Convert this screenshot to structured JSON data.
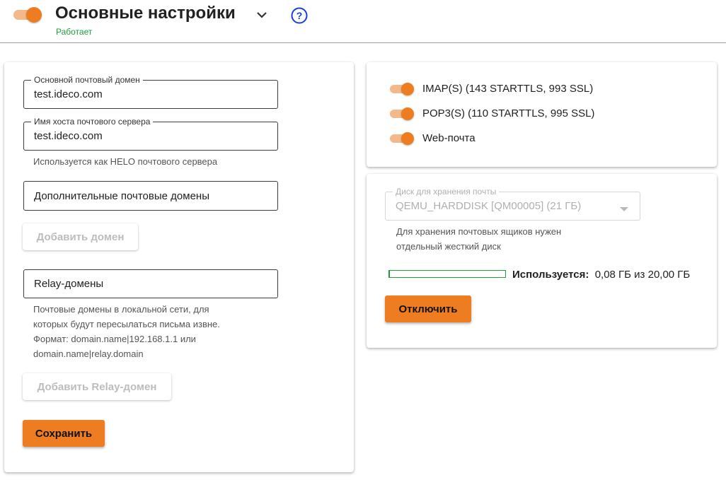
{
  "header": {
    "title": "Основные настройки",
    "status": "Работает",
    "enabled": true,
    "help_icon": "help-circle-icon",
    "chevron_icon": "chevron-down-icon"
  },
  "settings": {
    "primary_domain": {
      "label": "Основной почтовый домен",
      "value": "test.ideco.com"
    },
    "hostname": {
      "label": "Имя хоста почтового сервера",
      "value": "test.ideco.com",
      "hint": "Используется как HELO почтового сервера"
    },
    "extra_domains": {
      "placeholder": "Дополнительные почтовые домены",
      "add_button": "Добавить домен"
    },
    "relay_domains": {
      "placeholder": "Relay-домены",
      "hint_lines": [
        "Почтовые домены в локальной сети, для",
        "которых будут пересылаться письма извне.",
        "Формат: domain.name|192.168.1.1 или",
        "domain.name|relay.domain"
      ],
      "add_button": "Добавить Relay-домен"
    },
    "save_button": "Сохранить"
  },
  "services": [
    {
      "label": "IMAP(S) (143 STARTTLS, 993 SSL)",
      "enabled": true
    },
    {
      "label": "POP3(S) (110 STARTTLS, 995 SSL)",
      "enabled": true
    },
    {
      "label": "Web-почта",
      "enabled": true
    }
  ],
  "storage": {
    "disk_label": "Диск для хранения почты",
    "disk_value": "QEMU_HARDDISK [QM00005] (21 ГБ)",
    "hint_lines": [
      "Для хранения почтовых ящиков нужен",
      "отдельный жесткий диск"
    ],
    "usage_label": "Используется:",
    "usage_value": "0,08 ГБ из 20,00 ГБ",
    "usage_fraction": 0.004,
    "disable_button": "Отключить"
  },
  "colors": {
    "accent": "#ed7d20",
    "accent_light": "#f3b98a",
    "success": "#1f9d3a",
    "help_blue": "#1a3fd6"
  }
}
